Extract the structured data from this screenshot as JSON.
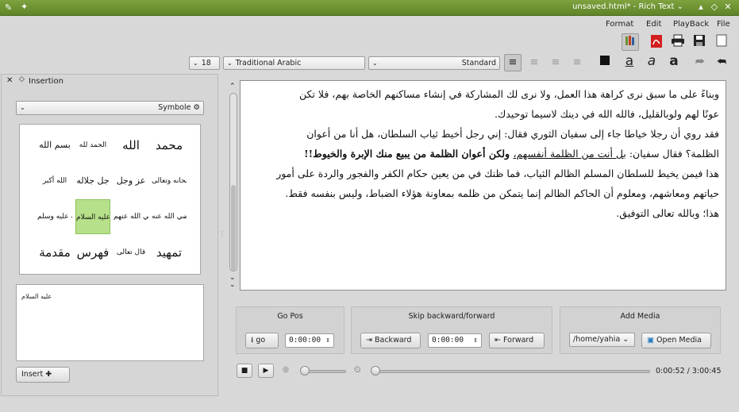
{
  "window": {
    "title": "unsaved.html* - Rich Text",
    "title_suffix": "⌄"
  },
  "menu": {
    "items": [
      "Format",
      "Edit",
      "PlayBack",
      "File"
    ]
  },
  "format_bar": {
    "font_size": "18",
    "font_family": "Traditional Arabic",
    "style": "Standard"
  },
  "insertion": {
    "title": "Insertion",
    "combo_label": "Symbole",
    "symbols": [
      [
        "بسم الله",
        "الحمد لله",
        "الله",
        "محمد"
      ],
      [
        "الله أكبر",
        "جل جلاله",
        "عز وجل",
        "سبحانه وتعالى"
      ],
      [
        "صلى الله عليه وسلم",
        "عليه السلام",
        "رضي الله عنهم",
        "رضي الله عنه"
      ],
      [
        "مقدمة",
        "فهرس",
        "قال تعالى",
        "تمهيد"
      ]
    ],
    "selected": [
      2,
      1
    ],
    "preview_text": "عليه السلام",
    "insert_label": "Insert"
  },
  "editor": {
    "lines": [
      {
        "t": "وبناءً على ما سبق نرى كراهة هذا العمل، ولا نرى لك المشاركة في إنشاء مساكنهم الخاصة بهم، فلا تكن"
      },
      {
        "t": "عونًا لهم ولوبالقليل، فالله الله في دينك لاسيما توحيدك."
      },
      {
        "t": "فقد روي أن رجلا خياطا جاء إلى سفيان الثوري فقال: إني رجل أخيط ثياب السلطان، هل أنا من أعوان"
      },
      {
        "a": "الظلمة؟ فقال سفيان: ",
        "u": "بل أنت من الظلمة أنفسهم،",
        "b": " ولكن أعوان الظلمة من يبيع منك الإبرة والخيوط!!"
      },
      {
        "t": "هذا فيمن يخيط للسلطان المسلم الظالم الثياب، فما ظنك في من يعين حكام الكفر والفجور والردة على أمور"
      },
      {
        "t": "حياتهم ومعاشهم، ومعلوم أن الحاكم الظالم إنما يتمكن من ظلمه بمعاونة هؤلاء الضباط، وليس بنفسه فقط."
      },
      {
        "t": "هذا؛ وبالله تعالى التوفيق."
      }
    ]
  },
  "media": {
    "go_pos": {
      "title": "Go Pos",
      "button": "go",
      "time": "0:00:00"
    },
    "skip": {
      "title": "Skip backward/forward",
      "backward": "Backward",
      "time": "0:00:00",
      "forward": "Forward"
    },
    "add_media": {
      "title": "Add Media",
      "path": "/home/yahia",
      "open": "Open Media"
    },
    "position": "0:00:52 / 3:00:45",
    "progress_fraction": 0.0048
  },
  "colors": {
    "titlebar": "#6a8f30",
    "selected_symbol": "#b6e08a",
    "pdf_red": "#d21f1f"
  }
}
